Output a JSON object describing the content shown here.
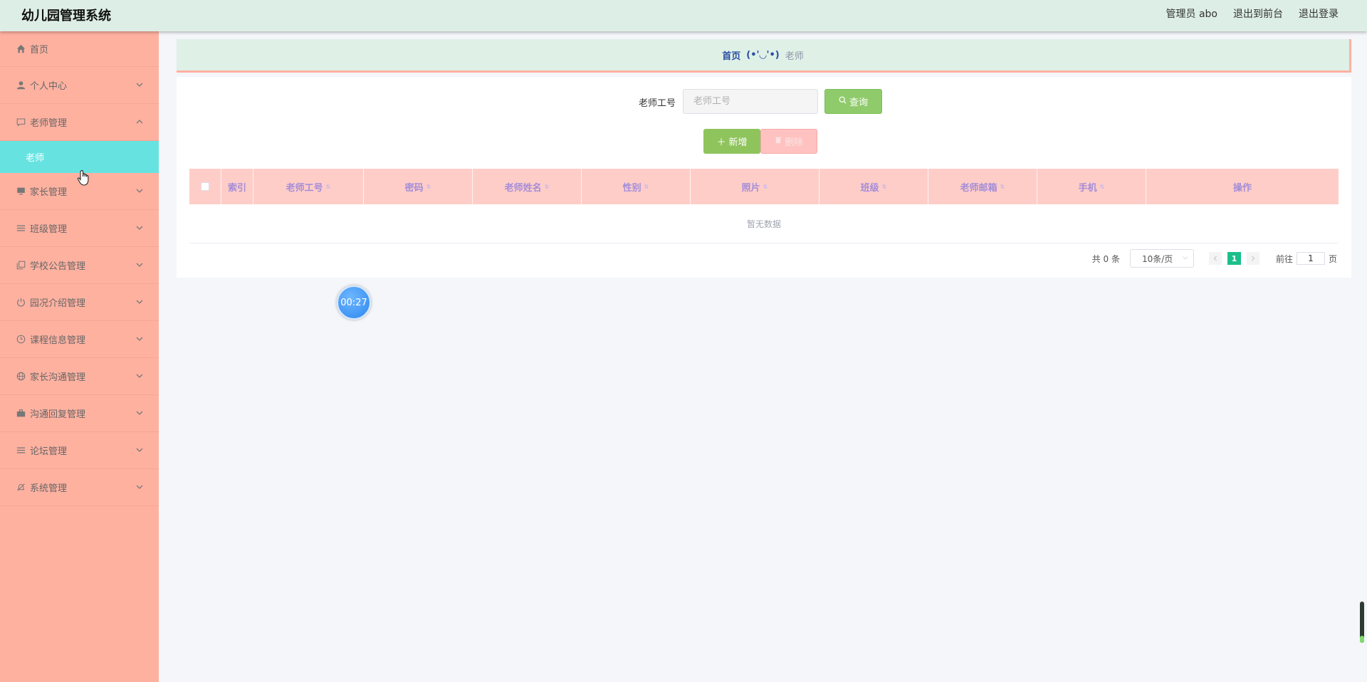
{
  "header": {
    "app_title": "幼儿园管理系统",
    "admin_label": "管理员 abo",
    "exit_to_front": "退出到前台",
    "logout": "退出登录"
  },
  "sidebar": {
    "items": [
      {
        "label": "首页",
        "icon": "home-icon"
      },
      {
        "label": "个人中心",
        "icon": "user-icon"
      },
      {
        "label": "老师管理",
        "icon": "chat-icon",
        "expanded": true,
        "sub": [
          "老师"
        ]
      },
      {
        "label": "家长管理",
        "icon": "monitor-icon"
      },
      {
        "label": "班级管理",
        "icon": "list-icon"
      },
      {
        "label": "学校公告管理",
        "icon": "copy-icon"
      },
      {
        "label": "园况介绍管理",
        "icon": "power-icon"
      },
      {
        "label": "课程信息管理",
        "icon": "clock-icon"
      },
      {
        "label": "家长沟通管理",
        "icon": "globe-icon"
      },
      {
        "label": "沟通回复管理",
        "icon": "briefcase-icon"
      },
      {
        "label": "论坛管理",
        "icon": "list-icon"
      },
      {
        "label": "系统管理",
        "icon": "bell-off-icon"
      }
    ]
  },
  "breadcrumb": {
    "home": "首页",
    "separator": "(•'◡'•)",
    "current": "老师"
  },
  "search": {
    "label": "老师工号",
    "placeholder": "老师工号",
    "query_button": "查询"
  },
  "actions": {
    "add": "新增",
    "delete": "删除"
  },
  "table": {
    "columns": [
      "索引",
      "老师工号",
      "密码",
      "老师姓名",
      "性别",
      "照片",
      "班级",
      "老师邮箱",
      "手机",
      "操作"
    ],
    "empty_text": "暂无数据"
  },
  "pagination": {
    "total": "共 0 条",
    "page_size": "10条/页",
    "current_page": "1",
    "goto_prefix": "前往",
    "goto_value": "1",
    "goto_suffix": "页"
  },
  "timer": "00:27",
  "colors": {
    "sidebar_bg": "#ffb1a0",
    "active_sub": "#66e3e1",
    "header_bg": "#ddeee6",
    "table_head": "#ffcdc8",
    "query_btn": "#8fcb6b",
    "page_active": "#1bbf8a"
  }
}
